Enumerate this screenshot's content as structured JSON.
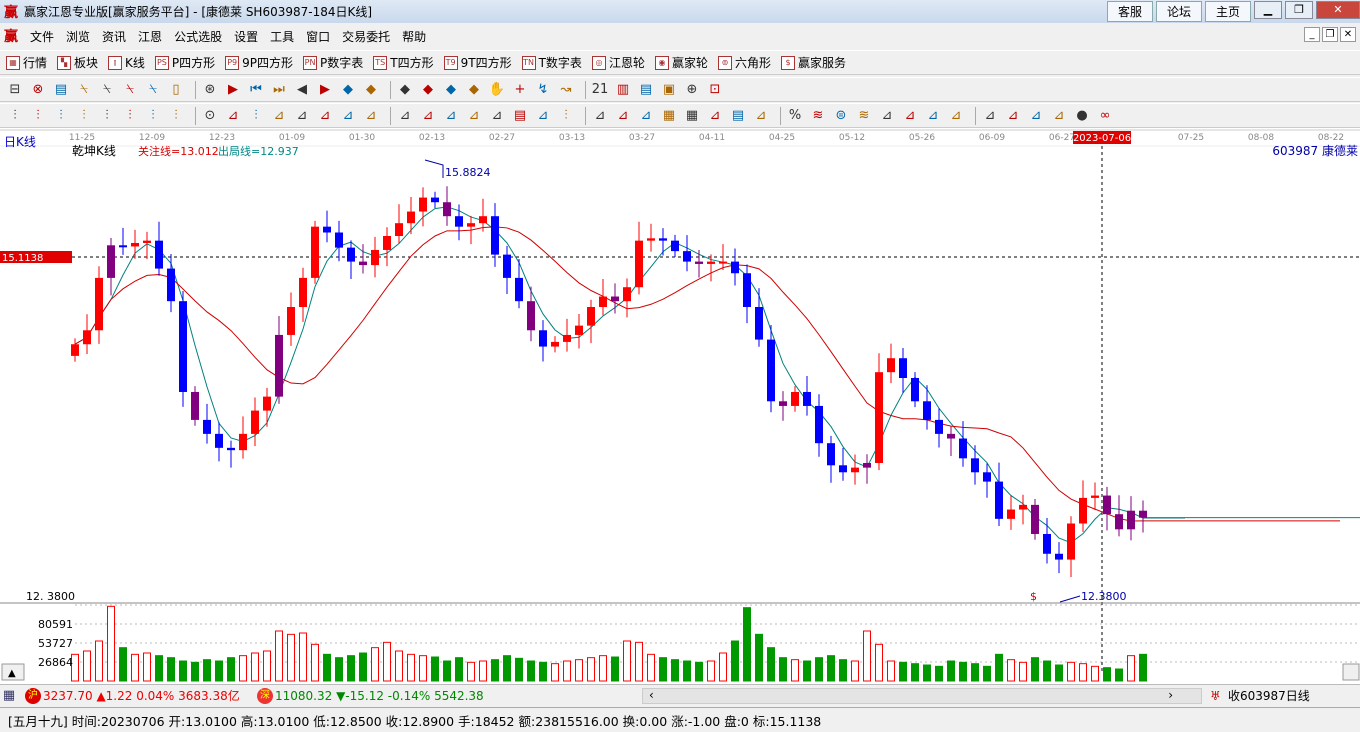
{
  "window": {
    "title": "赢家江恩专业版[赢家服务平台] - [康德莱  SH603987-184日K线]",
    "logo": "赢",
    "links": [
      "客服",
      "论坛",
      "主页"
    ]
  },
  "menu": [
    "文件",
    "浏览",
    "资讯",
    "江恩",
    "公式选股",
    "设置",
    "工具",
    "窗口",
    "交易委托",
    "帮助"
  ],
  "toolbar1": [
    {
      "icon": "grid-icon",
      "glyph": "▦",
      "label": "行情"
    },
    {
      "icon": "blocks-icon",
      "glyph": "▚",
      "label": "板块"
    },
    {
      "icon": "candles-icon",
      "glyph": "⫾",
      "label": "K线"
    },
    {
      "icon": "ps-icon",
      "glyph": "PS",
      "label": "P四方形"
    },
    {
      "icon": "p9-icon",
      "glyph": "P9",
      "label": "9P四方形"
    },
    {
      "icon": "pn-icon",
      "glyph": "PN",
      "label": "P数字表"
    },
    {
      "icon": "ts-icon",
      "glyph": "TS",
      "label": "T四方形"
    },
    {
      "icon": "t9-icon",
      "glyph": "T9",
      "label": "9T四方形"
    },
    {
      "icon": "tn-icon",
      "glyph": "TN",
      "label": "T数字表"
    },
    {
      "icon": "gann-wheel-icon",
      "glyph": "◎",
      "label": "江恩轮"
    },
    {
      "icon": "winner-wheel-icon",
      "glyph": "◉",
      "label": "赢家轮"
    },
    {
      "icon": "hexagon-icon",
      "glyph": "⊚",
      "label": "六角形"
    },
    {
      "icon": "dollar-icon",
      "glyph": "$",
      "label": "赢家服务"
    }
  ],
  "toolbar2": [
    "⊟",
    "⊗",
    "▤",
    "⍀",
    "⍀",
    "⍀",
    "⍀",
    "▯",
    "⊛",
    "▶",
    "⏮",
    "⏭",
    "◀",
    "▶",
    "◆",
    "◆",
    "◆",
    "◆",
    "◆",
    "◆",
    "✋",
    "+",
    "↯",
    "↝",
    "21",
    "▥",
    "▤",
    "▣",
    "⊕",
    "⊡"
  ],
  "toolbar3": [
    "⫶",
    "⫶",
    "⫶",
    "⫶",
    "⫶",
    "⫶",
    "⫶",
    "⫶",
    "⊙",
    "⊿",
    "⫶",
    "⊿",
    "⊿",
    "⊿",
    "⊿",
    "⊿",
    "⊿",
    "⊿",
    "⊿",
    "⊿",
    "⊿",
    "▤",
    "⊿",
    "⫶",
    "⊿",
    "⊿",
    "⊿",
    "▦",
    "▦",
    "⊿",
    "▤",
    "⊿",
    "%",
    "≋",
    "⊜",
    "≋",
    "⊿",
    "⊿",
    "⊿",
    "⊿",
    "⊿",
    "⊿",
    "⊿",
    "⊿",
    "●",
    "∞"
  ],
  "chart": {
    "period_label": "日K线",
    "indicator_name": "乾坤K线",
    "watch_line": "关注线=13.012",
    "exit_line": "出局线=12.937",
    "stock": "603987  康德莱",
    "dates": [
      "11-25",
      "12-09",
      "12-23",
      "01-09",
      "01-30",
      "02-13",
      "02-27",
      "03-13",
      "03-27",
      "04-11",
      "04-25",
      "05-12",
      "05-26",
      "06-09",
      "06-27",
      "2023-07-06",
      "07-25",
      "08-08",
      "08-22"
    ],
    "current_date_index": 15,
    "ref_price": "15.1138",
    "high_label": "15.8824",
    "low_label": "12.3800",
    "low_axis": "12. 3800",
    "low_marker": "$",
    "vol_axis": [
      "80591",
      "53727",
      "26864"
    ],
    "colors": {
      "up": "#ff0000",
      "down": "#0000ff",
      "special": "#800080",
      "vol_up": "#ff0000",
      "vol_down": "#009900",
      "ma_short": "#008080",
      "ma_long": "#d00000"
    }
  },
  "chart_data": {
    "type": "candlestick",
    "ylim": [
      12.2,
      15.98
    ],
    "closes": [
      14.38,
      14.5,
      14.95,
      15.23,
      15.22,
      15.25,
      15.27,
      15.03,
      14.75,
      13.97,
      13.73,
      13.61,
      13.49,
      13.47,
      13.61,
      13.81,
      13.93,
      14.46,
      14.7,
      14.95,
      15.39,
      15.34,
      15.21,
      15.09,
      15.06,
      15.19,
      15.31,
      15.42,
      15.52,
      15.64,
      15.6,
      15.48,
      15.39,
      15.42,
      15.48,
      15.15,
      14.95,
      14.75,
      14.5,
      14.36,
      14.4,
      14.46,
      14.54,
      14.7,
      14.79,
      14.75,
      14.87,
      15.27,
      15.29,
      15.27,
      15.18,
      15.09,
      15.07,
      15.09,
      15.09,
      14.99,
      14.7,
      14.42,
      13.89,
      13.85,
      13.97,
      13.85,
      13.53,
      13.34,
      13.28,
      13.32,
      13.36,
      14.14,
      14.26,
      14.09,
      13.89,
      13.73,
      13.61,
      13.57,
      13.4,
      13.28,
      13.2,
      12.88,
      12.96,
      13.0,
      12.75,
      12.58,
      12.53,
      12.84,
      13.06,
      13.08,
      12.92,
      12.79,
      12.95,
      12.89
    ],
    "volumes": [
      40000,
      45000,
      60000,
      112000,
      50000,
      40000,
      42000,
      38000,
      35000,
      30000,
      28000,
      32000,
      30000,
      35000,
      38000,
      42000,
      45000,
      75000,
      70000,
      72000,
      55000,
      40000,
      35000,
      38000,
      42000,
      50000,
      58000,
      45000,
      40000,
      38000,
      36000,
      30000,
      35000,
      28000,
      30000,
      32000,
      38000,
      34000,
      30000,
      28000,
      26000,
      30000,
      32000,
      35000,
      38000,
      36000,
      60000,
      58000,
      40000,
      35000,
      32000,
      30000,
      28000,
      30000,
      42000,
      60000,
      110000,
      70000,
      50000,
      35000,
      32000,
      30000,
      35000,
      38000,
      32000,
      30000,
      75000,
      55000,
      30000,
      28000,
      26000,
      24000,
      22000,
      30000,
      28000,
      26000,
      22000,
      40000,
      32000,
      28000,
      35000,
      30000,
      24000,
      28000,
      26000,
      22000,
      20000,
      18000,
      38000,
      40000
    ]
  },
  "ticker": {
    "sh_badge": "沪",
    "sh": "3237.70 ▲1.22 0.04% 3683.38亿",
    "sz_badge": "深",
    "sz": "11080.32 ▼-15.12 -0.14% 5542.38",
    "right": "收603987日线"
  },
  "status": "[五月十九] 时间:20230706 开:13.0100 高:13.0100 低:12.8500 收:12.8900 手:18452 额:23815516.00 换:0.00 涨:-1.00 盘:0 标:15.1138"
}
